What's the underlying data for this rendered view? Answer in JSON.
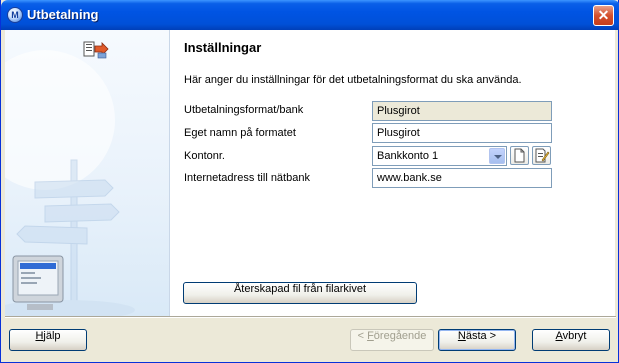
{
  "window": {
    "title": "Utbetalning",
    "icon_letter": "M",
    "close_symbol": "✕"
  },
  "page": {
    "heading": "Inställningar",
    "description": "Här anger du inställningar för det utbetalningsformat du ska använda."
  },
  "fields": {
    "format_label": "Utbetalningsformat/bank",
    "format_value": "Plusgirot",
    "name_label": "Eget namn på formatet",
    "name_value": "Plusgirot",
    "account_label": "Kontonr.",
    "account_value": "Bankkonto 1",
    "url_label": "Internetadress till nätbank",
    "url_value": "www.bank.se"
  },
  "buttons": {
    "recreate": "Återskapad fil från filarkivet",
    "help": {
      "mnemonic": "H",
      "rest": "jälp"
    },
    "previous": {
      "prefix": "< ",
      "mnemonic": "F",
      "rest": "öregående"
    },
    "next": {
      "mnemonic": "N",
      "rest": "ästa >"
    },
    "cancel": {
      "mnemonic": "A",
      "rest": "vbryt"
    }
  },
  "icons": {
    "header_icon": "payment-format-icon",
    "new_doc": "new-document-icon",
    "edit_doc": "edit-document-icon"
  },
  "colors": {
    "title_bar": "#0054e3",
    "close_button": "#d5502d",
    "panel": "#e9f2fb"
  }
}
